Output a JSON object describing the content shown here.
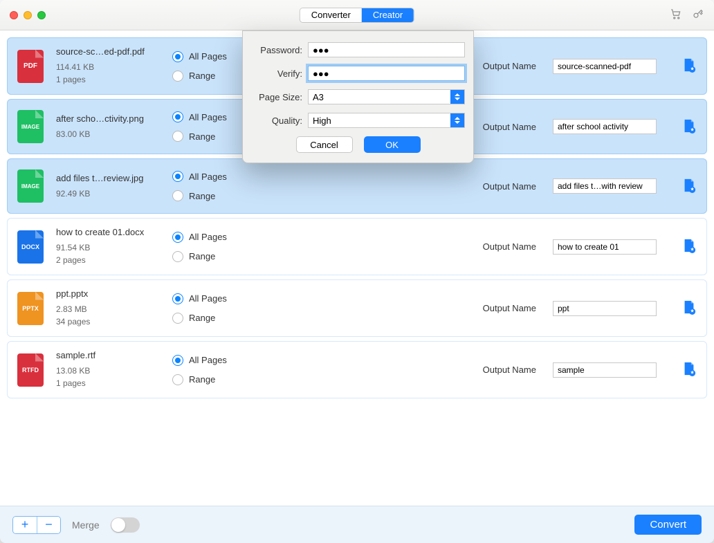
{
  "titlebar": {
    "tabs": {
      "converter": "Converter",
      "creator": "Creator",
      "active": "creator"
    }
  },
  "files": [
    {
      "type": "PDF",
      "iconClass": "fi-pdf",
      "name": "source-sc…ed-pdf.pdf",
      "size": "114.41 KB",
      "pages": "1 pages",
      "output": "source-scanned-pdf",
      "selected": true
    },
    {
      "type": "IMAGE",
      "iconClass": "fi-image",
      "name": "after scho…ctivity.png",
      "size": "83.00 KB",
      "pages": "",
      "output": "after school activity",
      "selected": true
    },
    {
      "type": "IMAGE",
      "iconClass": "fi-image",
      "name": "add files t…review.jpg",
      "size": "92.49 KB",
      "pages": "",
      "output": "add files t…with review",
      "selected": true
    },
    {
      "type": "DOCX",
      "iconClass": "fi-docx",
      "name": "how to create 01.docx",
      "size": "91.54 KB",
      "pages": "2 pages",
      "output": "how to create 01",
      "selected": false
    },
    {
      "type": "PPTX",
      "iconClass": "fi-pptx",
      "name": "ppt.pptx",
      "size": "2.83 MB",
      "pages": "34 pages",
      "output": "ppt",
      "selected": false
    },
    {
      "type": "RTFD",
      "iconClass": "fi-rtfd",
      "name": "sample.rtf",
      "size": "13.08 KB",
      "pages": "1 pages",
      "output": "sample",
      "selected": false
    }
  ],
  "row_labels": {
    "all_pages": "All Pages",
    "range": "Range",
    "output_name": "Output Name"
  },
  "bottom": {
    "merge": "Merge",
    "convert": "Convert"
  },
  "modal": {
    "password_label": "Password:",
    "verify_label": "Verify:",
    "page_size_label": "Page Size:",
    "quality_label": "Quality:",
    "password_value": "●●●",
    "verify_value": "●●●",
    "page_size_value": "A3",
    "quality_value": "High",
    "cancel": "Cancel",
    "ok": "OK"
  }
}
